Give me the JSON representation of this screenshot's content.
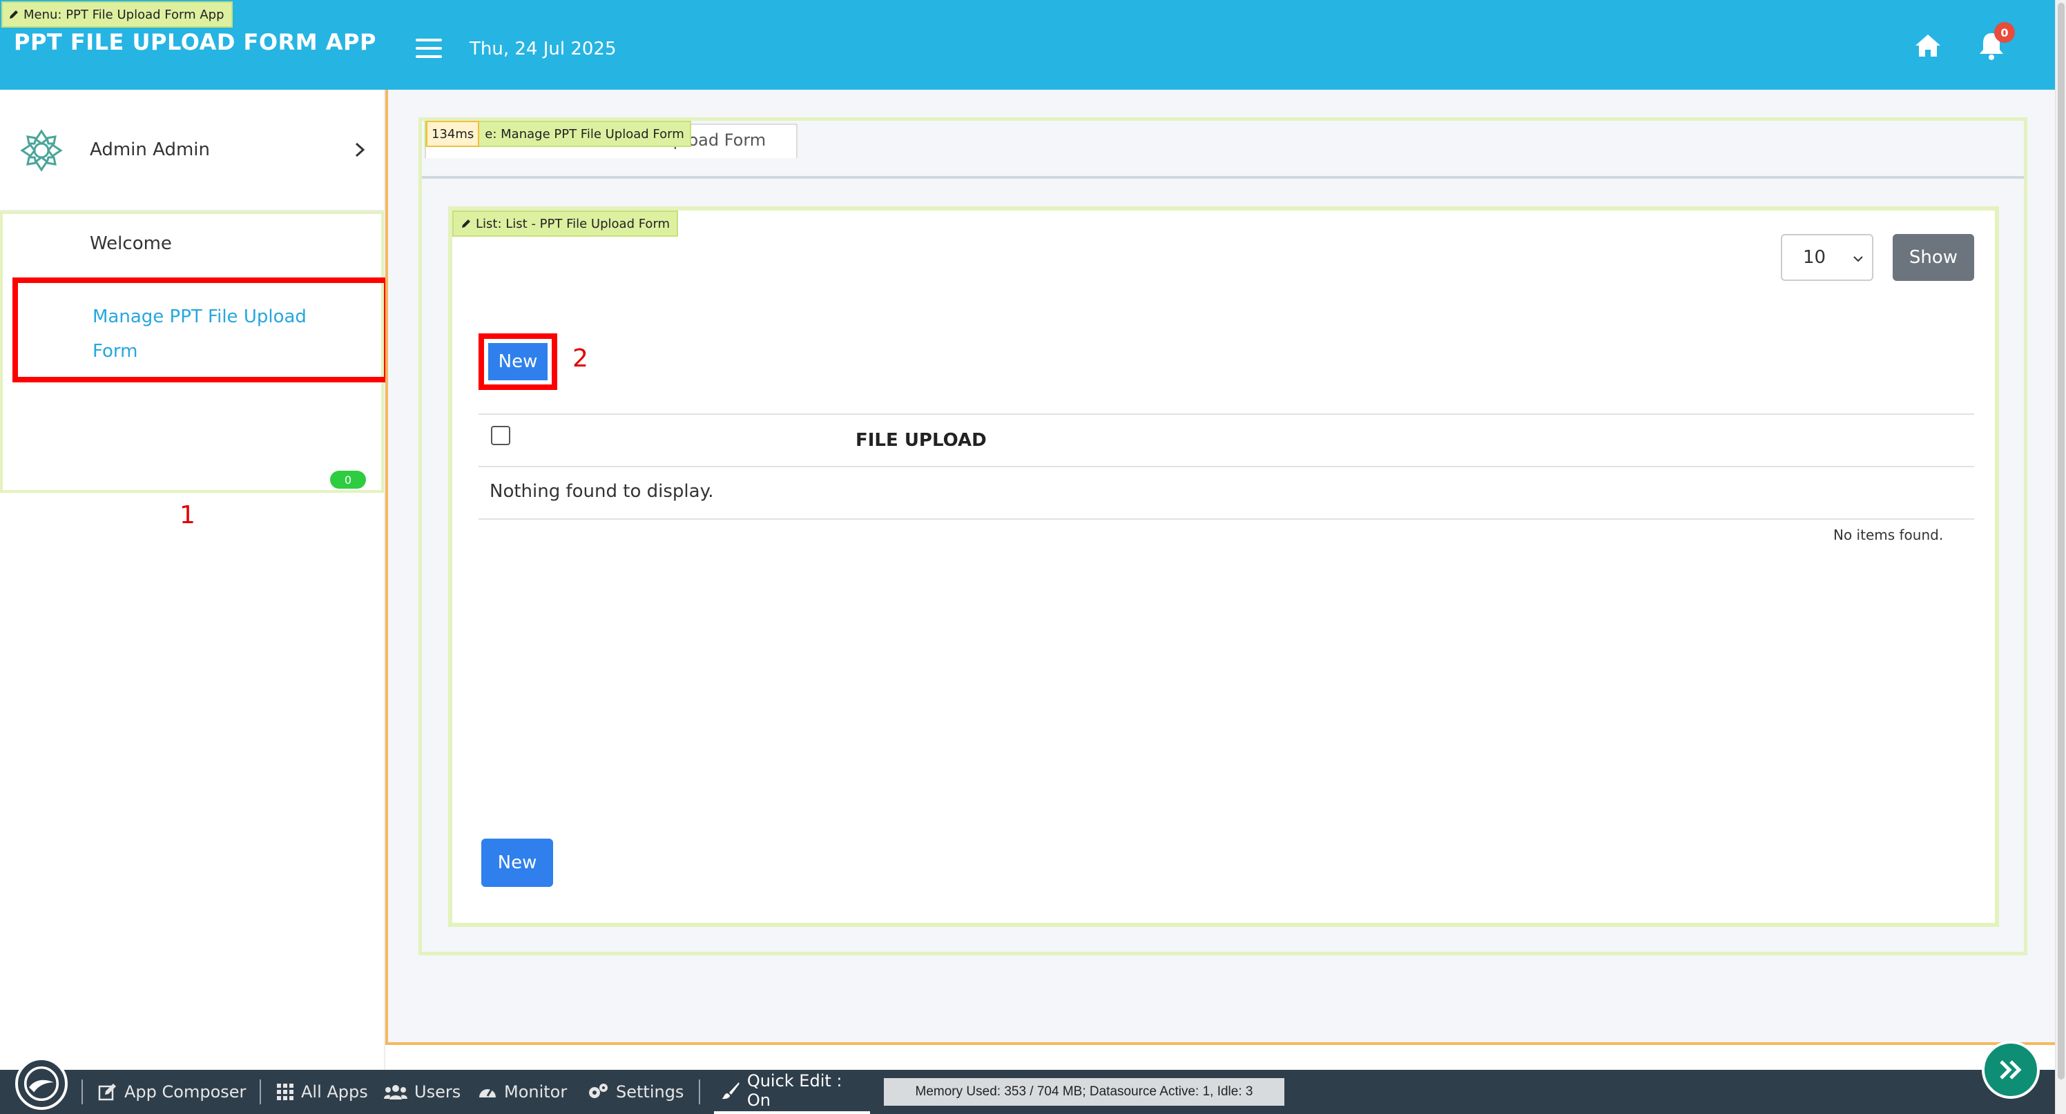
{
  "header": {
    "menu_tag": "Menu: PPT File Upload Form App",
    "app_title": "PPT FILE UPLOAD FORM APP",
    "date": "Thu, 24 Jul 2025",
    "notification_count": "0"
  },
  "sidebar": {
    "user_name": "Admin Admin",
    "items": [
      {
        "label": "Welcome"
      },
      {
        "label": "Manage PPT File Upload Form"
      }
    ],
    "badge": "0"
  },
  "annotations": {
    "first": "1",
    "second": "2"
  },
  "main": {
    "page_tag_timing": "134ms",
    "page_tag": "e: Manage PPT File Upload Form",
    "tab_label": "Upload Form",
    "list_tag": "List: List - PPT File Upload Form",
    "page_size": "10",
    "show_label": "Show",
    "new_label": "New",
    "table": {
      "columns": [
        "FILE UPLOAD"
      ],
      "empty_message": "Nothing found to display.",
      "footer_message": "No items found."
    }
  },
  "footer": {
    "app_composer": "App Composer",
    "all_apps": "All Apps",
    "users": "Users",
    "monitor": "Monitor",
    "settings": "Settings",
    "quick_edit": "Quick Edit : On",
    "memory": "Memory Used: 353 / 704 MB; Datasource Active: 1, Idle: 3"
  },
  "colors": {
    "header": "#26b4e3",
    "primary": "#2f80ed",
    "annotation": "#ff0000",
    "footer": "#2f3e4b"
  }
}
